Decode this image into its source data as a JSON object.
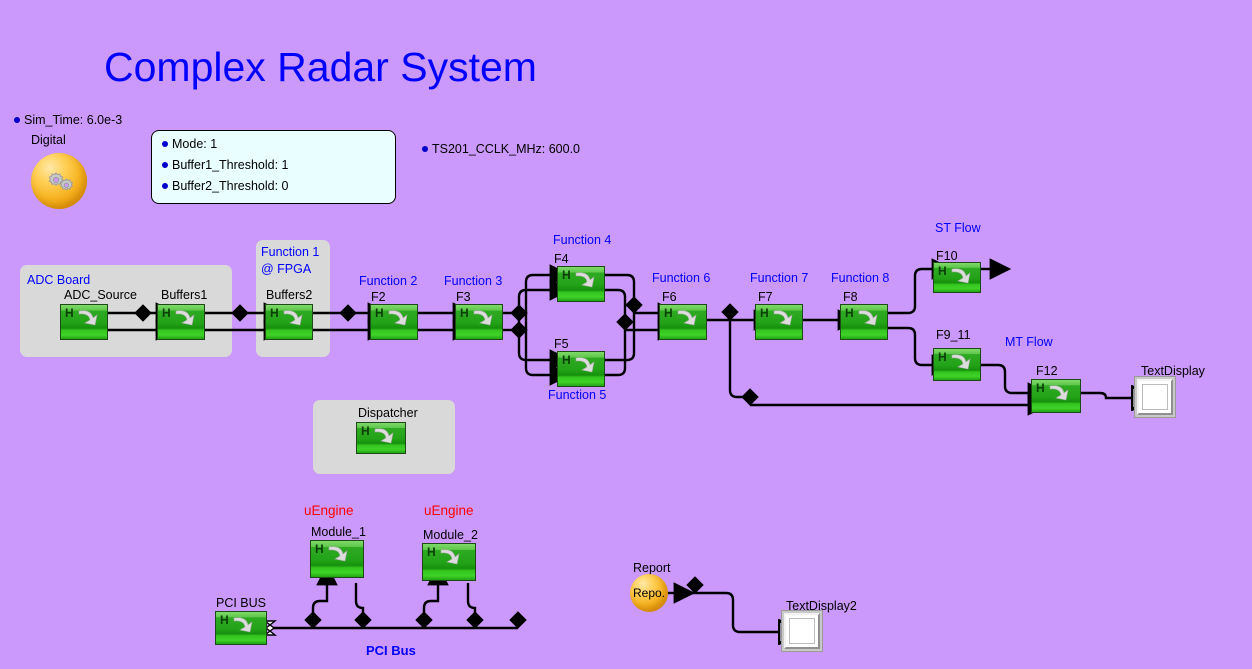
{
  "page": {
    "title": "Complex Radar System",
    "background_color": "#CB99FB",
    "title_color": "#0000FF"
  },
  "annotations": {
    "sim_time": "Sim_Time: 6.0e-3",
    "ts201": "TS201_CCLK_MHz: 600.0"
  },
  "param_box": {
    "items": [
      "Mode: 1",
      "Buffer1_Threshold: 1",
      "Buffer2_Threshold: 0"
    ]
  },
  "digital": {
    "label": "Digital",
    "icon": "gears-sphere-icon"
  },
  "groups": {
    "adc_board": "ADC Board",
    "fpga_line1": "Function 1",
    "fpga_line2": "@ FPGA",
    "dispatcher_group": ""
  },
  "flow_labels": {
    "function2": "Function 2",
    "function3": "Function 3",
    "function4": "Function 4",
    "function5": "Function 5",
    "function6": "Function 6",
    "function7": "Function 7",
    "function8": "Function 8",
    "st_flow": "ST Flow",
    "mt_flow": "MT Flow",
    "pci_bus_label": "PCI Bus"
  },
  "blocks": {
    "adc_source": "ADC_Source",
    "buffers1": "Buffers1",
    "buffers2": "Buffers2",
    "f2": "F2",
    "f3": "F3",
    "f4": "F4",
    "f5": "F5",
    "f6": "F6",
    "f7": "F7",
    "f8": "F8",
    "f10": "F10",
    "f9_11": "F9_11",
    "f12": "F12",
    "dispatcher": "Dispatcher",
    "module_1": "Module_1",
    "module_2": "Module_2",
    "pci_bus": "PCI BUS",
    "block_glyph": "H"
  },
  "uengine": {
    "label_1": "uEngine",
    "label_2": "uEngine",
    "color": "#FF0000"
  },
  "displays": {
    "text_display": "TextDisplay",
    "text_display2": "TextDisplay2"
  },
  "report": {
    "label": "Report",
    "inner_text": "Repo."
  }
}
